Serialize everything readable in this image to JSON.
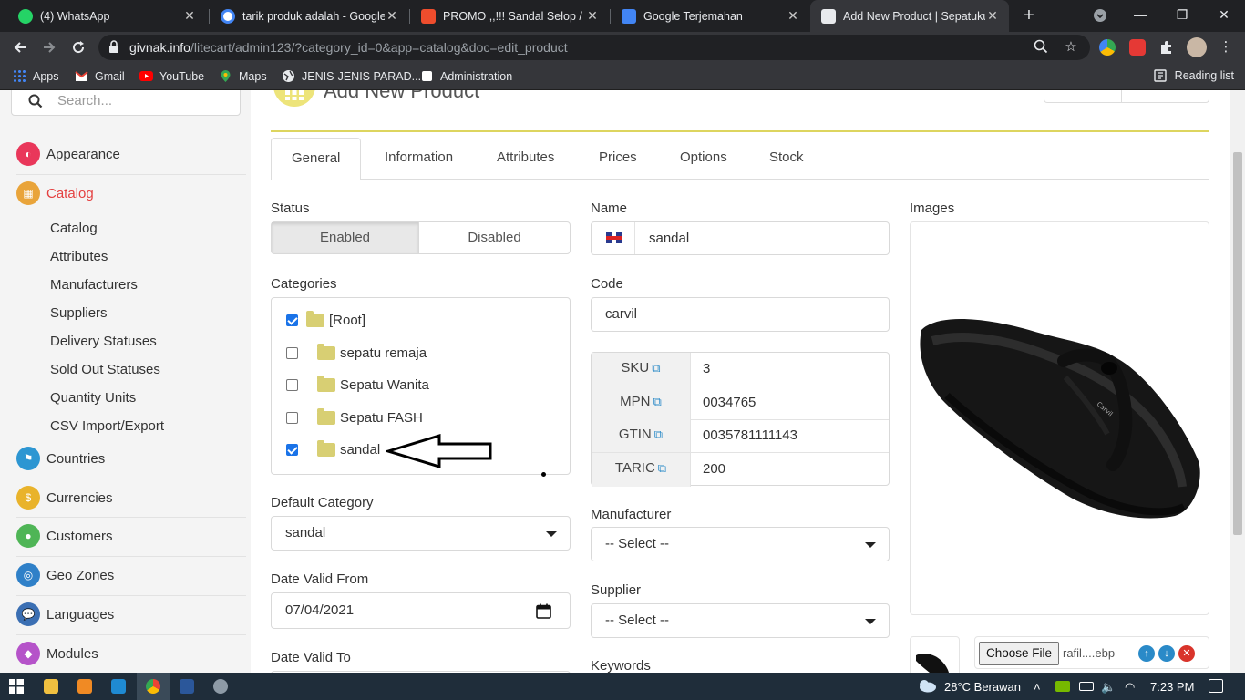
{
  "browser": {
    "tabs": [
      {
        "title": "(4) WhatsApp",
        "icon": "whatsapp-icon",
        "color": "#25d366"
      },
      {
        "title": "tarik produk adalah - Google",
        "icon": "google-icon",
        "color": "#ffffff"
      },
      {
        "title": "PROMO ,,!!! Sandal Selop / Sl",
        "icon": "shop-icon",
        "color": "#ee4d2d"
      },
      {
        "title": "Google Terjemahan",
        "icon": "translate-icon",
        "color": "#4285f4"
      },
      {
        "title": "Add New Product | Sepatuku",
        "icon": "page-icon",
        "color": "#e8eaed",
        "active": true
      }
    ],
    "url_domain": "givnak.info",
    "url_path": "/litecart/admin123/?category_id=0&app=catalog&doc=edit_product",
    "bookmarks": [
      {
        "label": "Apps",
        "icon": "apps-grid-icon"
      },
      {
        "label": "Gmail",
        "icon": "gmail-icon"
      },
      {
        "label": "YouTube",
        "icon": "youtube-icon"
      },
      {
        "label": "Maps",
        "icon": "maps-icon"
      },
      {
        "label": "JENIS-JENIS PARAD...",
        "icon": "globe-icon"
      },
      {
        "label": "Administration",
        "icon": "admin-icon"
      }
    ],
    "reading_list": "Reading list"
  },
  "sidebar": {
    "search_placeholder": "Search...",
    "items": [
      {
        "label": "Appearance",
        "color": "#e9375a"
      },
      {
        "label": "Catalog",
        "color": "#e9a43a",
        "current": true
      },
      {
        "label": "Countries",
        "color": "#2d96d2"
      },
      {
        "label": "Currencies",
        "color": "#e9b32b"
      },
      {
        "label": "Customers",
        "color": "#4fb556"
      },
      {
        "label": "Geo Zones",
        "color": "#2f80c8"
      },
      {
        "label": "Languages",
        "color": "#3b6fb3"
      },
      {
        "label": "Modules",
        "color": "#b553c9"
      }
    ],
    "catalog_sub": [
      "Catalog",
      "Attributes",
      "Manufacturers",
      "Suppliers",
      "Delivery Statuses",
      "Sold Out Statuses",
      "Quantity Units",
      "CSV Import/Export"
    ]
  },
  "main": {
    "title": "Add New Product",
    "tabs": [
      "General",
      "Information",
      "Attributes",
      "Prices",
      "Options",
      "Stock"
    ],
    "status_label": "Status",
    "status_options": [
      "Enabled",
      "Disabled"
    ],
    "categories_label": "Categories",
    "categories": [
      {
        "name": "[Root]",
        "checked": true
      },
      {
        "name": "sepatu remaja",
        "checked": false
      },
      {
        "name": "Sepatu Wanita",
        "checked": false
      },
      {
        "name": "Sepatu FASH",
        "checked": false
      },
      {
        "name": "sandal",
        "checked": true
      }
    ],
    "default_category_label": "Default Category",
    "default_category_value": "sandal",
    "date_valid_from_label": "Date Valid From",
    "date_valid_from_value": "07/04/2021",
    "date_valid_to_label": "Date Valid To",
    "name_label": "Name",
    "name_value": "sandal",
    "code_label": "Code",
    "code_value": "carvil",
    "codes": [
      {
        "key": "SKU",
        "value": "3"
      },
      {
        "key": "MPN",
        "value": "0034765"
      },
      {
        "key": "GTIN",
        "value": "0035781111143"
      },
      {
        "key": "TARIC",
        "value": "200"
      }
    ],
    "manufacturer_label": "Manufacturer",
    "manufacturer_value": "-- Select --",
    "supplier_label": "Supplier",
    "supplier_value": "-- Select --",
    "keywords_label": "Keywords",
    "images_label": "Images",
    "choose_file": "Choose File",
    "file_name": "rafil....ebp"
  },
  "taskbar": {
    "weather": "28°C  Berawan",
    "time": "7:23 PM"
  }
}
